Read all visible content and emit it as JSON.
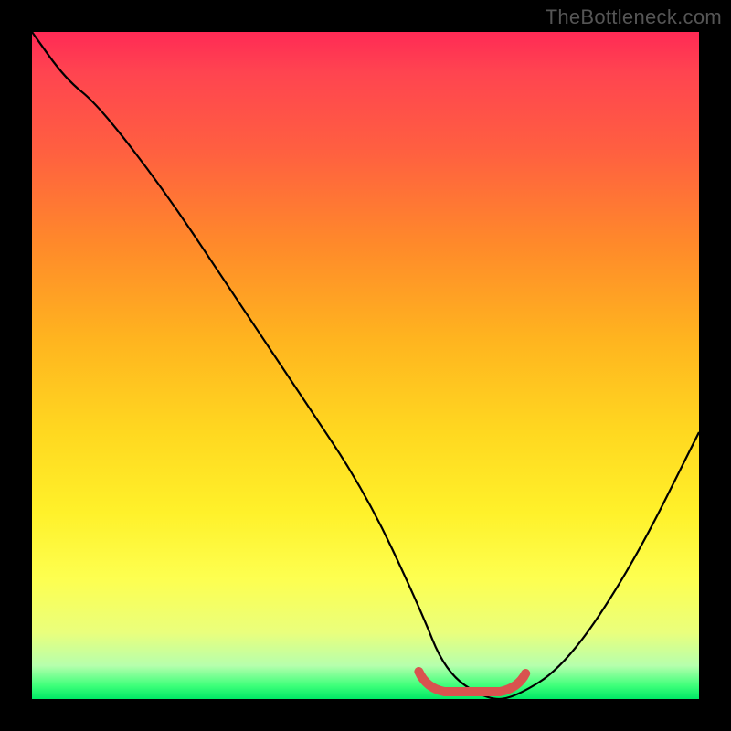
{
  "watermark": "TheBottleneck.com",
  "chart_data": {
    "type": "line",
    "title": "",
    "xlabel": "",
    "ylabel": "",
    "x_range": [
      0,
      100
    ],
    "y_range": [
      0,
      100
    ],
    "series": [
      {
        "name": "bottleneck-curve",
        "x": [
          0,
          5,
          10,
          20,
          30,
          40,
          50,
          58,
          62,
          68,
          72,
          80,
          90,
          100
        ],
        "y": [
          100,
          93,
          89,
          76,
          61,
          46,
          31,
          14,
          4,
          0,
          0,
          5,
          20,
          40
        ]
      }
    ],
    "highlight_segment": {
      "name": "optimal-range",
      "x_start": 58,
      "x_end": 74,
      "color": "#d9534f"
    },
    "gradient_stops": [
      {
        "pos": 0,
        "color": "#ff2a55"
      },
      {
        "pos": 50,
        "color": "#ffd820"
      },
      {
        "pos": 85,
        "color": "#fdff50"
      },
      {
        "pos": 100,
        "color": "#00e865"
      }
    ]
  }
}
